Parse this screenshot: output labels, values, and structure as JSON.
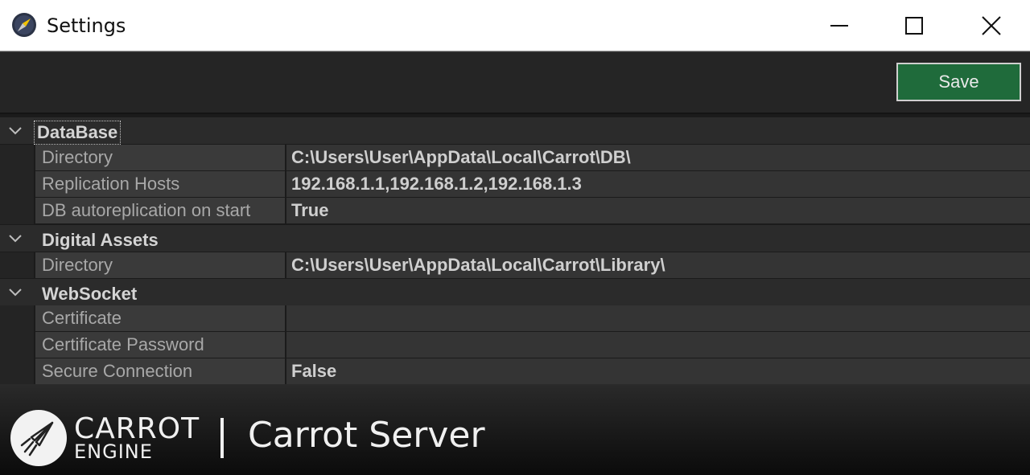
{
  "window": {
    "title": "Settings"
  },
  "toolbar": {
    "save_label": "Save"
  },
  "property_grid": {
    "categories": [
      {
        "label": "DataBase",
        "properties": [
          {
            "name": "Directory",
            "value": "C:\\Users\\User\\AppData\\Local\\Carrot\\DB\\"
          },
          {
            "name": "Replication Hosts",
            "value": "192.168.1.1,192.168.1.2,192.168.1.3"
          },
          {
            "name": "DB autoreplication on start",
            "value": "True"
          }
        ]
      },
      {
        "label": "Digital Assets",
        "properties": [
          {
            "name": "Directory",
            "value": "C:\\Users\\User\\AppData\\Local\\Carrot\\Library\\"
          }
        ]
      },
      {
        "label": "WebSocket",
        "properties": [
          {
            "name": "Certificate",
            "value": ""
          },
          {
            "name": "Certificate Password",
            "value": ""
          },
          {
            "name": "Secure Connection",
            "value": "False"
          }
        ]
      }
    ]
  },
  "banner": {
    "brand_line1": "CARROT",
    "brand_line2": "ENGINE",
    "product": "Carrot Server"
  },
  "colors": {
    "save_button": "#1f6b3b",
    "background": "#1e1e1e"
  }
}
